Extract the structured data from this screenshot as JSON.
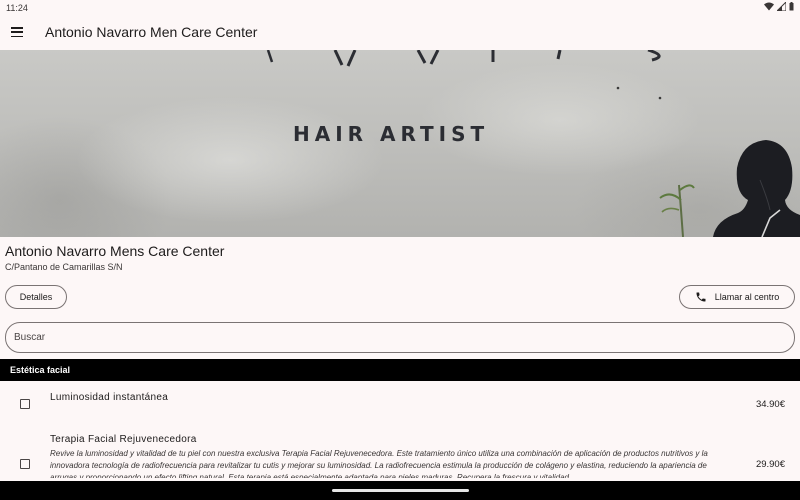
{
  "status_bar": {
    "time": "11:24"
  },
  "app_bar": {
    "title": "Antonio Navarro Men Care Center"
  },
  "hero": {
    "sign_text": "HAIR ARTIST"
  },
  "center": {
    "name": "Antonio Navarro Mens Care Center",
    "address": "C/Pantano de Camarillas S/N"
  },
  "actions": {
    "details_label": "Detalles",
    "call_label": "Llamar al centro"
  },
  "search": {
    "placeholder": "Buscar",
    "value": ""
  },
  "category": {
    "label": "Estética facial"
  },
  "services": [
    {
      "name": "Luminosidad instantánea",
      "description": "",
      "price": "34.90€",
      "selected": false
    },
    {
      "name": "Terapia Facial Rejuvenecedora",
      "description": "Revive la luminosidad y vitalidad de tu piel con nuestra exclusiva Terapia Facial Rejuvenecedora. Este tratamiento único utiliza una combinación de aplicación de productos nutritivos y la innovadora tecnología de radiofrecuencia para revitalizar tu cutis y mejorar su luminosidad. La radiofrecuencia estimula la producción de colágeno y elastina, reduciendo la apariencia de arrugas y proporcionando un efecto lifting natural. Esta terapia está especialmente adaptada para pieles maduras. Recupera la frescura y vitalidad",
      "price": "29.90€",
      "selected": false
    }
  ]
}
